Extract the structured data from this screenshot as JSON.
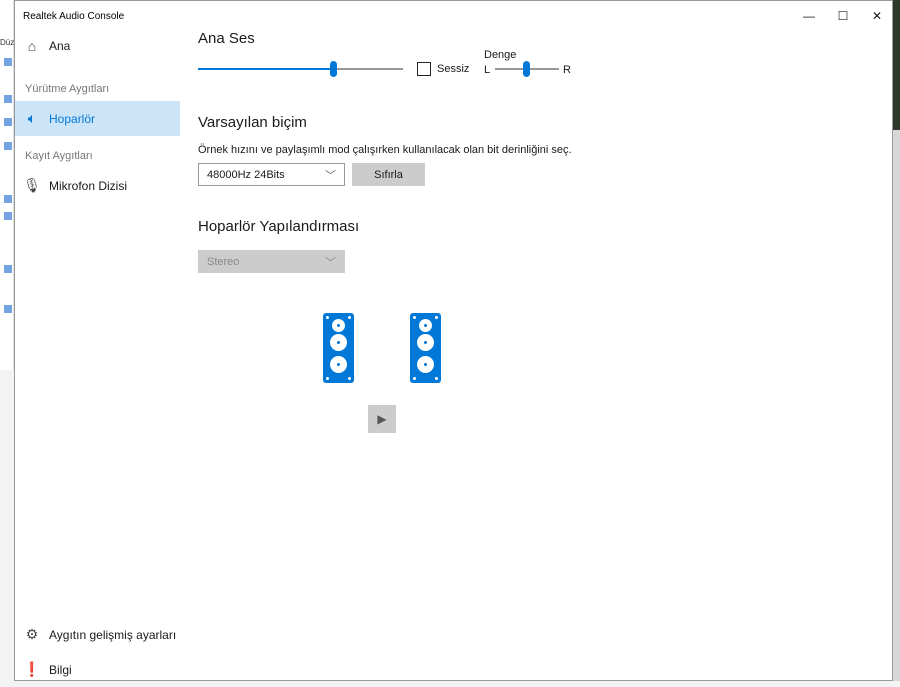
{
  "window": {
    "title": "Realtek Audio Console",
    "minimize": "—",
    "maximize": "☐",
    "close": "✕"
  },
  "background": {
    "explorer_label": "Düz"
  },
  "sidebar": {
    "home": "Ana",
    "playback_section": "Yürütme Aygıtları",
    "speaker": "Hoparlör",
    "recording_section": "Kayıt Aygıtları",
    "microphone": "Mikrofon Dizisi",
    "advanced": "Aygıtın gelişmiş ayarları",
    "info": "Bilgi"
  },
  "main_volume": {
    "title": "Ana Ses",
    "value": 0.66,
    "mute_label": "Sessiz",
    "muted": false,
    "balance_label": "Denge",
    "balance_left": "L",
    "balance_right": "R",
    "balance_value": 0.48
  },
  "default_format": {
    "title": "Varsayılan biçim",
    "description": "Örnek hızını ve paylaşımlı mod çalışırken kullanılacak olan bit derinliğini seç.",
    "selected": "48000Hz 24Bits",
    "reset": "Sıfırla"
  },
  "speaker_config": {
    "title": "Hoparlör Yapılandırması",
    "selected": "Stereo",
    "play": "▶"
  },
  "colors": {
    "accent": "#0078d7",
    "selected_bg": "#cce4f7"
  }
}
